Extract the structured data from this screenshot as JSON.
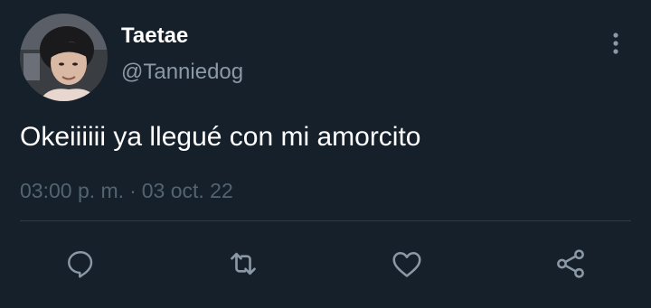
{
  "tweet": {
    "author": {
      "display_name": "Taetae",
      "handle": "@Tanniedog"
    },
    "text": "Okeiiiiii ya llegué con mi amorcito",
    "time": "03:00 p. m.",
    "separator": "·",
    "date": "03 oct. 22"
  },
  "icons": {
    "more": "more-vertical-icon",
    "reply": "reply-icon",
    "retweet": "retweet-icon",
    "like": "heart-icon",
    "share": "share-icon"
  },
  "colors": {
    "background": "#15202b",
    "primary_text": "#ffffff",
    "secondary_text": "#8b98a5",
    "meta_text": "#536471",
    "icon": "#8b98a5",
    "divider": "#2f3a45"
  }
}
